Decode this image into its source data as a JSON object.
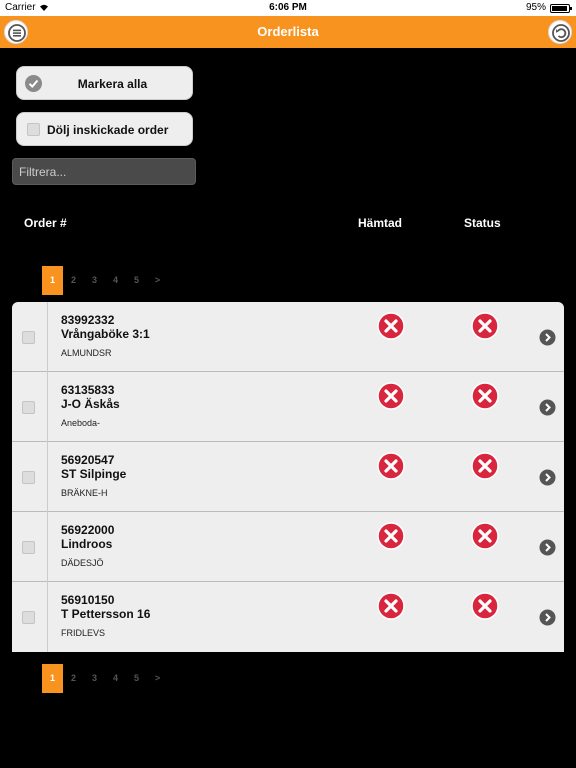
{
  "statusbar": {
    "carrier": "Carrier",
    "time": "6:06 PM",
    "battery": "95%",
    "battery_level": 0.95
  },
  "nav": {
    "title": "Orderlista",
    "left_icon": "menu-icon",
    "right_icon": "undo-icon"
  },
  "controls": {
    "mark_all": "Markera alla",
    "hide_sent": "Dölj inskickade order",
    "filter_placeholder": "Filtrera..."
  },
  "columns": {
    "order": "Order #",
    "hamtad": "Hämtad",
    "status": "Status"
  },
  "pagination": {
    "pages": [
      "1",
      "2",
      "3",
      "4",
      "5",
      ">"
    ],
    "current": "1"
  },
  "orders": [
    {
      "number": "83992332",
      "name": "Vrångaböke 3:1",
      "place": "ALMUNDSR",
      "hamtad": "no",
      "status": "no"
    },
    {
      "number": "63135833",
      "name": "J-O Äskås",
      "place": "Aneboda-",
      "hamtad": "no",
      "status": "no"
    },
    {
      "number": "56920547",
      "name": "ST Silpinge",
      "place": "BRÄKNE-H",
      "hamtad": "no",
      "status": "no"
    },
    {
      "number": "56922000",
      "name": "Lindroos",
      "place": "DÄDESJÖ",
      "hamtad": "no",
      "status": "no"
    },
    {
      "number": "56910150",
      "name": "T Pettersson 16",
      "place": "FRIDLEVS",
      "hamtad": "no",
      "status": "no"
    }
  ],
  "colors": {
    "accent": "#f7931e",
    "status_no": "#d7263d",
    "background": "#000000"
  }
}
